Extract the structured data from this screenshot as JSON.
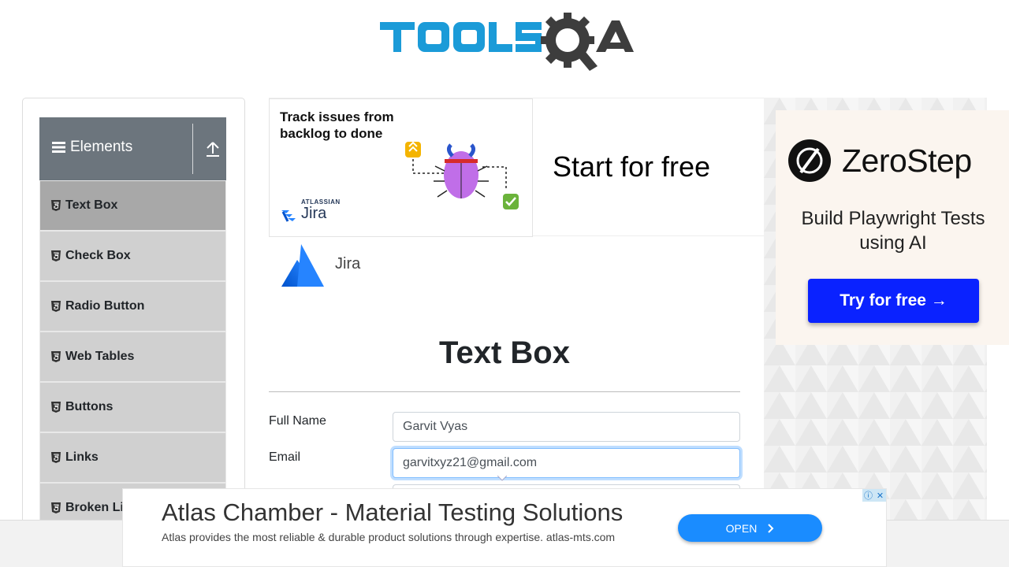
{
  "header": {
    "logo_text": "TOOLSQA"
  },
  "sidebar": {
    "group_title": "Elements",
    "items": [
      {
        "label": "Text Box",
        "active": true
      },
      {
        "label": "Check Box"
      },
      {
        "label": "Radio Button"
      },
      {
        "label": "Web Tables"
      },
      {
        "label": "Buttons"
      },
      {
        "label": "Links"
      },
      {
        "label": "Broken Links - Images"
      }
    ]
  },
  "banner_ad": {
    "image_text": "Track issues from backlog to done",
    "brand_small": "ATLASSIAN",
    "brand": "Jira",
    "headline": "Start for free",
    "advertiser": "Jira"
  },
  "main": {
    "title": "Text Box",
    "fields": [
      {
        "label": "Full Name",
        "value": "Garvit Vyas"
      },
      {
        "label": "Email",
        "value": "garvitxyz21@gmail.com"
      }
    ]
  },
  "right_ad": {
    "brand": "ZeroStep",
    "subtitle": "Build Playwright Tests using AI",
    "button": "Try for free →"
  },
  "bottom_ad": {
    "headline": "Atlas Chamber - Material Testing Solutions",
    "description": "Atlas provides the most reliable & durable product solutions through expertise. atlas-mts.com",
    "button": "OPEN"
  },
  "colors": {
    "toolsqa_blue": "#1b9bd8",
    "sidebar_header": "#6c757d",
    "menu_active": "#a8a8a8",
    "menu_item": "#d0d0d0",
    "zerostep_button": "#0a22ff",
    "open_button": "#1a8cff"
  }
}
